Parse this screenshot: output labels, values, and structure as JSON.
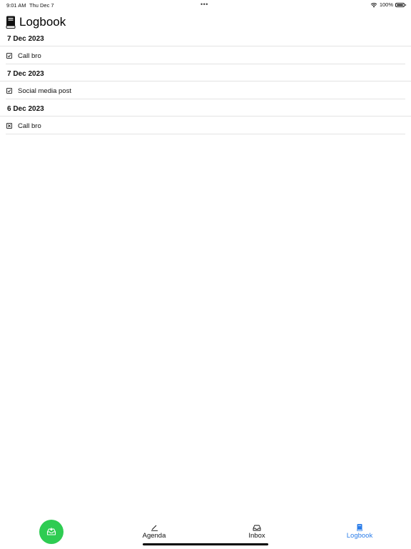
{
  "status_bar": {
    "time": "9:01 AM",
    "date": "Thu Dec 7",
    "dots": "•••",
    "battery": "100%",
    "wifi_icon": "wifi-icon",
    "battery_icon": "battery-icon"
  },
  "header": {
    "title": "Logbook",
    "icon": "book-icon"
  },
  "groups": [
    {
      "date": "7 Dec 2023",
      "items": [
        {
          "label": "Call bro",
          "status": "completed",
          "icon": "checkbox-checked-icon"
        }
      ]
    },
    {
      "date": "7 Dec 2023",
      "items": [
        {
          "label": "Social media post",
          "status": "completed",
          "icon": "checkbox-checked-icon"
        }
      ]
    },
    {
      "date": "6 Dec 2023",
      "items": [
        {
          "label": "Call bro",
          "status": "cancelled",
          "icon": "checkbox-cancelled-icon"
        }
      ]
    }
  ],
  "bottom_bar": {
    "fab_icon": "inbox-add-icon",
    "fab_color": "#2ecc52",
    "tabs": [
      {
        "label": "Agenda",
        "icon": "pencil-icon",
        "active": false
      },
      {
        "label": "Inbox",
        "icon": "inbox-tray-icon",
        "active": false
      },
      {
        "label": "Logbook",
        "icon": "book-icon",
        "active": true
      }
    ],
    "active_color": "#2b7de9"
  }
}
